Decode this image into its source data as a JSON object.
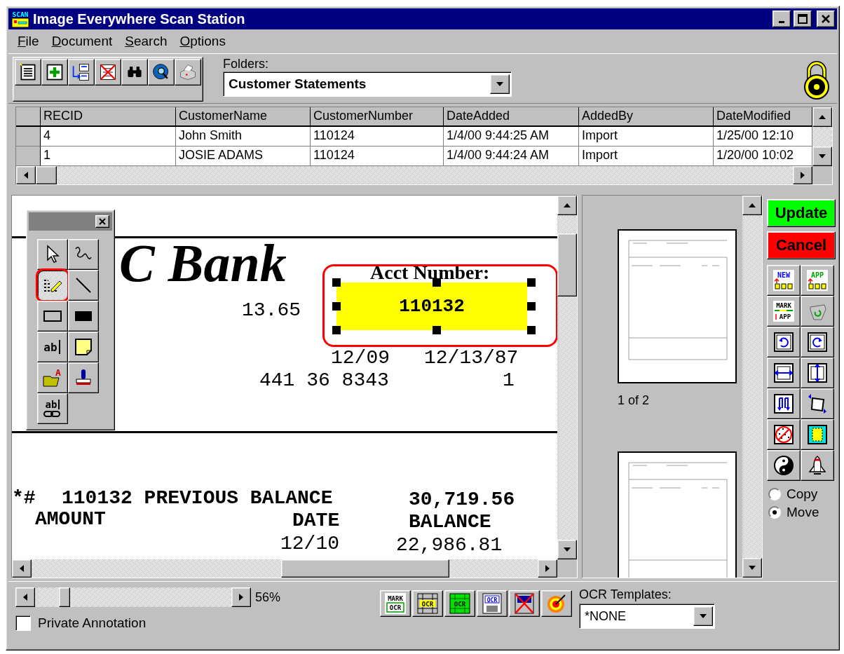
{
  "window": {
    "title": "Image Everywhere Scan Station",
    "icon_text": "SCAN"
  },
  "menu": [
    {
      "label": "File"
    },
    {
      "label": "Document"
    },
    {
      "label": "Search"
    },
    {
      "label": "Options"
    }
  ],
  "toolbar": {
    "buttons": [
      {
        "kind": "new-document"
      },
      {
        "kind": "add"
      },
      {
        "kind": "move-records"
      },
      {
        "kind": "delete"
      },
      {
        "kind": "binoculars"
      },
      {
        "kind": "globe-search"
      },
      {
        "kind": "printer"
      }
    ],
    "folders_label": "Folders:",
    "folder": "Customer Statements"
  },
  "grid": {
    "columns": [
      "RECID",
      "CustomerName",
      "CustomerNumber",
      "DateAdded",
      "AddedBy",
      "DateModified"
    ],
    "rows": [
      [
        "4",
        "John Smith",
        "110124",
        "1/4/00 9:44:25 AM",
        "Import",
        "1/25/00 12:10"
      ],
      [
        "1",
        "JOSIE ADAMS",
        "110124",
        "1/4/00 9:44:24 AM",
        "Import",
        "1/20/00 10:02"
      ]
    ]
  },
  "document": {
    "texts": [
      {
        "kind": "logo",
        "text": "C Bank"
      },
      {
        "kind": "label",
        "text": "Acct Number:"
      },
      {
        "kind": "mono",
        "text": "13.65"
      },
      {
        "kind": "mono",
        "text": "12/09"
      },
      {
        "kind": "mono",
        "text": "12/13/87"
      },
      {
        "kind": "mono",
        "text": "441 36 8343"
      },
      {
        "kind": "mono",
        "text": "1"
      },
      {
        "kind": "bold",
        "text": "*#"
      },
      {
        "kind": "bold",
        "text": "110132 PREVIOUS BALANCE"
      },
      {
        "kind": "bold",
        "text": "30,719.56"
      },
      {
        "kind": "bold",
        "text": "AMOUNT"
      },
      {
        "kind": "bold",
        "text": "DATE"
      },
      {
        "kind": "bold",
        "text": "BALANCE"
      },
      {
        "kind": "mono",
        "text": "12/10"
      },
      {
        "kind": "mono",
        "text": "22,986.81"
      }
    ],
    "highlight": {
      "text": "110132",
      "selected": true
    }
  },
  "palette": {
    "tools": [
      {
        "kind": "pointer",
        "selected": false
      },
      {
        "kind": "freehand",
        "selected": false
      },
      {
        "kind": "highlighter",
        "selected": true
      },
      {
        "kind": "line",
        "selected": false
      },
      {
        "kind": "hollow-rectangle",
        "selected": false
      },
      {
        "kind": "filled-rectangle",
        "selected": false
      },
      {
        "kind": "text",
        "text": "ab",
        "selected": false
      },
      {
        "kind": "sticky-note",
        "selected": false
      },
      {
        "kind": "text-from-file",
        "text": "A",
        "selected": false
      },
      {
        "kind": "stamp",
        "selected": false
      },
      {
        "kind": "linked-text",
        "text": "ab",
        "selected": false
      }
    ]
  },
  "thumbnails": {
    "caption": "1 of 2"
  },
  "actions": [
    {
      "kind": "update",
      "label": "Update"
    },
    {
      "kind": "cancel",
      "label": "Cancel"
    }
  ],
  "tools": [
    {
      "kind": "new-batch",
      "text": "NEW"
    },
    {
      "kind": "append-batch",
      "text": "APP"
    },
    {
      "kind": "mark-append",
      "text": "MARK",
      "subtext": "APP"
    },
    {
      "kind": "recycle"
    },
    {
      "kind": "rotate-left"
    },
    {
      "kind": "rotate-right"
    },
    {
      "kind": "fit-width"
    },
    {
      "kind": "fit-height"
    },
    {
      "kind": "page-flow"
    },
    {
      "kind": "deskew"
    },
    {
      "kind": "despeckle"
    },
    {
      "kind": "crop"
    },
    {
      "kind": "yin-yang"
    },
    {
      "kind": "launch"
    }
  ],
  "transfer": [
    {
      "label": "Copy",
      "selected": false
    },
    {
      "label": "Move",
      "selected": true
    }
  ],
  "zoom": {
    "level": 0.13,
    "reading": "56%"
  },
  "private_annotation": {
    "label": "Private Annotation",
    "checked": false
  },
  "ocr_buttons": [
    {
      "kind": "mark-ocr",
      "text": "MARK",
      "subtext": "OCR"
    },
    {
      "kind": "ocr-zone",
      "text": "OCR"
    },
    {
      "kind": "ocr-grid",
      "text": "OCR"
    },
    {
      "kind": "ocr-save",
      "text": "OCR"
    },
    {
      "kind": "ocr-delete"
    },
    {
      "kind": "target"
    }
  ],
  "ocr_templates": {
    "label": "OCR Templates:",
    "value": "*NONE"
  }
}
